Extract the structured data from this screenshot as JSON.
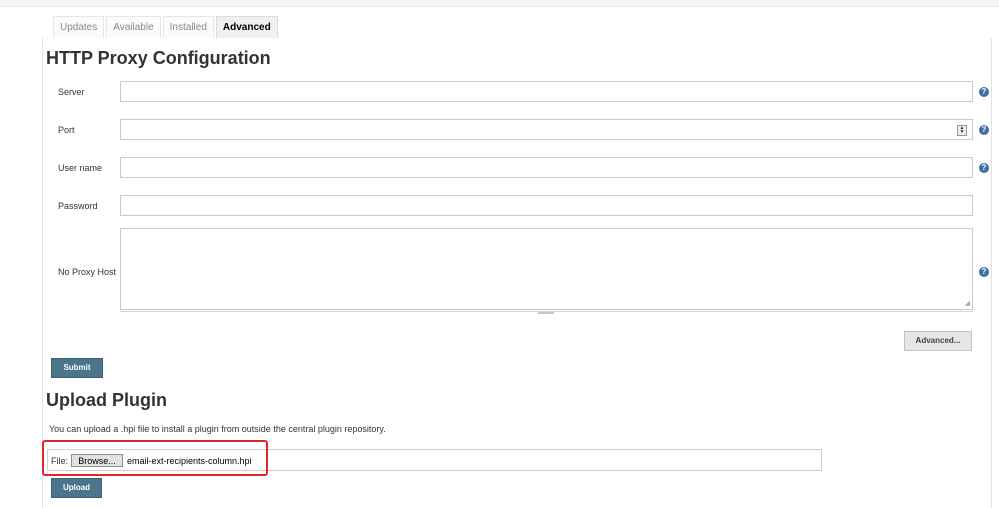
{
  "tabs": [
    {
      "label": "Updates"
    },
    {
      "label": "Available"
    },
    {
      "label": "Installed"
    },
    {
      "label": "Advanced",
      "active": true
    }
  ],
  "proxy": {
    "title": "HTTP Proxy Configuration",
    "fields": {
      "server": {
        "label": "Server",
        "value": ""
      },
      "port": {
        "label": "Port",
        "value": ""
      },
      "username": {
        "label": "User name",
        "value": ""
      },
      "password": {
        "label": "Password",
        "value": ""
      },
      "no_proxy_host": {
        "label": "No Proxy Host",
        "value": ""
      }
    },
    "help_glyph": "?",
    "advanced_button": "Advanced...",
    "submit_button": "Submit"
  },
  "upload": {
    "title": "Upload Plugin",
    "description": "You can upload a .hpi file to install a plugin from outside the central plugin repository.",
    "file_label": "File:",
    "browse_button": "Browse...",
    "selected_file": "email-ext-recipients-column.hpi",
    "upload_button": "Upload"
  },
  "colors": {
    "button_primary": "#4b758b",
    "help_icon": "#3e6fa3",
    "highlight_box": "#e02626"
  }
}
